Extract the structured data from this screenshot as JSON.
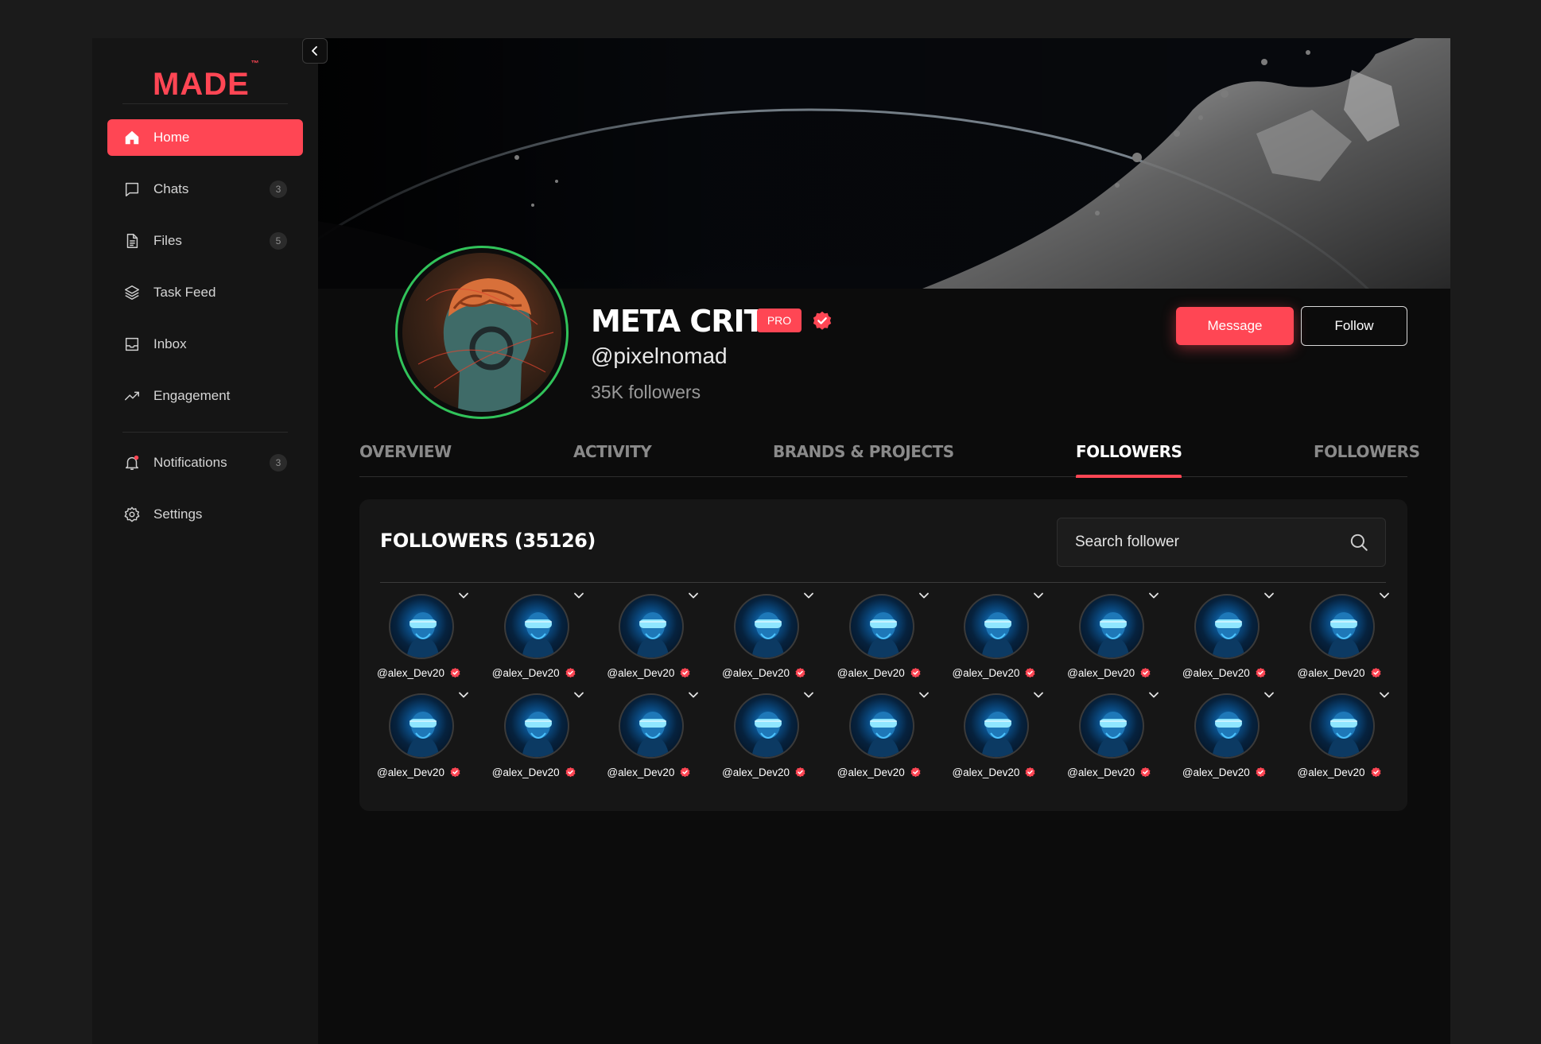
{
  "brand": {
    "name": "MADE",
    "tm": "™"
  },
  "sidebar": {
    "items": [
      {
        "label": "Home",
        "icon": "home-icon",
        "active": true
      },
      {
        "label": "Chats",
        "icon": "chat-icon",
        "badge": "3"
      },
      {
        "label": "Files",
        "icon": "file-icon",
        "badge": "5"
      },
      {
        "label": "Task Feed",
        "icon": "layers-icon"
      },
      {
        "label": "Inbox",
        "icon": "inbox-icon"
      },
      {
        "label": "Engagement",
        "icon": "trend-icon"
      },
      {
        "label": "Notifications",
        "icon": "bell-icon",
        "badge": "3"
      },
      {
        "label": "Settings",
        "icon": "gear-icon"
      }
    ]
  },
  "profile": {
    "name": "META CRIT",
    "badge": "PRO",
    "handle": "@pixelnomad",
    "followers": "35K followers",
    "message_label": "Message",
    "follow_label": "Follow"
  },
  "tabs": [
    "OVERVIEW",
    "ACTIVITY",
    "BRANDS & PROJECTS",
    "FOLLOWERS",
    "FOLLOWERS"
  ],
  "active_tab": 3,
  "followers_panel": {
    "title": "FOLLOWERS (35126)",
    "search_placeholder": "Search follower",
    "items": [
      "@alex_Dev20",
      "@alex_Dev20",
      "@alex_Dev20",
      "@alex_Dev20",
      "@alex_Dev20",
      "@alex_Dev20",
      "@alex_Dev20",
      "@alex_Dev20",
      "@alex_Dev20",
      "@alex_Dev20",
      "@alex_Dev20",
      "@alex_Dev20",
      "@alex_Dev20",
      "@alex_Dev20",
      "@alex_Dev20",
      "@alex_Dev20",
      "@alex_Dev20",
      "@alex_Dev20"
    ]
  },
  "colors": {
    "accent": "#ff4654",
    "avatar_ring": "#31c35a",
    "background": "#0c0c0c",
    "sidebar": "#151515"
  }
}
